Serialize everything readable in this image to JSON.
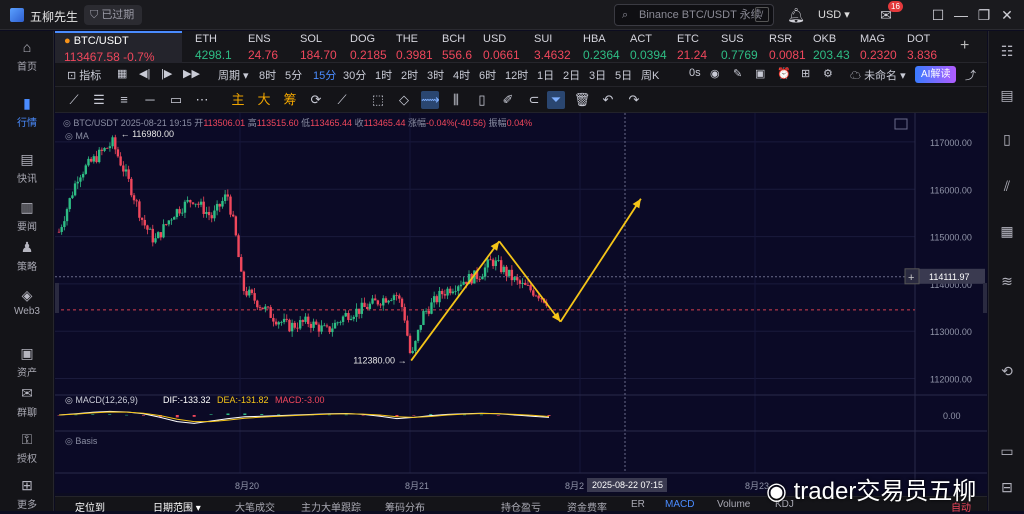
{
  "app": {
    "name": "五柳先生",
    "expired_label": "已过期",
    "search_placeholder": "Binance BTC/USDT 永续",
    "currency": "USD",
    "notification_count": "16"
  },
  "sidebar": [
    {
      "label": "首页",
      "icon": "home-icon",
      "glyph": "⌂"
    },
    {
      "label": "行情",
      "icon": "market-bars-icon",
      "glyph": "▮",
      "active": true
    },
    {
      "label": "快讯",
      "icon": "news-flash-icon",
      "glyph": "▤"
    },
    {
      "label": "要闻",
      "icon": "headline-icon",
      "glyph": "▥"
    },
    {
      "label": "策略",
      "icon": "strategy-icon",
      "glyph": "♟"
    },
    {
      "label": "Web3",
      "icon": "web3-icon",
      "glyph": "◈"
    },
    {
      "label": "资产",
      "icon": "asset-icon",
      "glyph": "▣"
    },
    {
      "label": "群聊",
      "icon": "group-chat-icon",
      "glyph": "✉"
    },
    {
      "label": "授权",
      "icon": "authorize-icon",
      "glyph": "⚿"
    },
    {
      "label": "更多",
      "icon": "more-grid-icon",
      "glyph": "⊞"
    }
  ],
  "tickers": [
    {
      "name": "BTC/USDT",
      "price": "113467.58",
      "change": "-0.7%",
      "dir": "dn"
    },
    {
      "name": "ETH",
      "price": "4298.1",
      "dir": "up"
    },
    {
      "name": "ENS",
      "price": "24.76",
      "dir": "dn"
    },
    {
      "name": "SOL",
      "price": "184.70",
      "dir": "dn"
    },
    {
      "name": "DOG",
      "price": "0.2185",
      "dir": "dn"
    },
    {
      "name": "THE",
      "price": "0.3981",
      "dir": "dn"
    },
    {
      "name": "BCH",
      "price": "556.6",
      "dir": "dn"
    },
    {
      "name": "USD",
      "price": "0.0661",
      "dir": "dn"
    },
    {
      "name": "SUI",
      "price": "3.4632",
      "dir": "dn"
    },
    {
      "name": "HBA",
      "price": "0.2364",
      "dir": "up"
    },
    {
      "name": "ACT",
      "price": "0.0394",
      "dir": "up"
    },
    {
      "name": "ETC",
      "price": "21.24",
      "dir": "dn"
    },
    {
      "name": "SUS",
      "price": "0.7769",
      "dir": "up"
    },
    {
      "name": "RSR",
      "price": "0.0081",
      "dir": "dn"
    },
    {
      "name": "OKB",
      "price": "203.43",
      "dir": "up"
    },
    {
      "name": "MAG",
      "price": "0.2320",
      "dir": "dn"
    },
    {
      "name": "DOT",
      "price": "3.836",
      "dir": "dn"
    }
  ],
  "toolbar": {
    "indicator": "指标",
    "period": "周期",
    "intervals": [
      "8时",
      "5分",
      "15分",
      "30分",
      "1时",
      "2时",
      "3时",
      "4时",
      "6时",
      "12时",
      "1日",
      "2日",
      "3日",
      "5日",
      "周K"
    ],
    "selected_interval": "15分",
    "offset": "0s",
    "unnamed": "未命名",
    "ai": "AI解读"
  },
  "draw_chinese": [
    "主",
    "大",
    "筹"
  ],
  "chart": {
    "legend_symbol": "BTC/USDT",
    "legend_time": "2025-08-21 19:15",
    "open_label": "开",
    "open": "113506.01",
    "high_label": "高",
    "high": "113515.60",
    "low_label": "低",
    "low": "113465.44",
    "close_label": "收",
    "close": "113465.44",
    "change_label": "涨幅",
    "change": "-0.04%(-40.56)",
    "amp_label": "振幅",
    "amp": "0.04%",
    "ma_label": "MA",
    "macd_label": "MACD(12,26,9)",
    "dif_label": "DIF:",
    "dif": "-133.32",
    "dea_label": "DEA:",
    "dea": "-131.82",
    "macd_val_label": "MACD:",
    "macd_val": "-3.00",
    "basis_label": "Basis",
    "high_mark": "116980.00",
    "low_mark": "112380.00",
    "price_ticks": [
      "117000.00",
      "116000.00",
      "115000.00",
      "114000.00",
      "113000.00",
      "112000.00"
    ],
    "macd_zero": "0.00",
    "crosshair_price": "114111.97",
    "date_ticks": [
      "8月20",
      "8月21",
      "8月2",
      "8月23"
    ],
    "crosshair_time": "2025-08-22 07:15",
    "accent_up": "#2ebd85",
    "accent_down": "#f0475c",
    "arrow_color": "#f5c518"
  },
  "chart_data": {
    "type": "candlestick",
    "ylim": [
      111800,
      117400
    ],
    "x_ticks": [
      "8月20",
      "8月21",
      "8月2",
      "8月23"
    ],
    "path_points": [
      [
        0,
        115100
      ],
      [
        5,
        116300
      ],
      [
        10,
        116700
      ],
      [
        14,
        116980
      ],
      [
        18,
        116200
      ],
      [
        22,
        115300
      ],
      [
        25,
        114900
      ],
      [
        30,
        115500
      ],
      [
        35,
        115800
      ],
      [
        40,
        115400
      ],
      [
        44,
        115900
      ],
      [
        46,
        115100
      ],
      [
        48,
        113900
      ],
      [
        52,
        113600
      ],
      [
        56,
        113300
      ],
      [
        60,
        113100
      ],
      [
        65,
        113200
      ],
      [
        70,
        113000
      ],
      [
        75,
        113350
      ],
      [
        80,
        113500
      ],
      [
        85,
        113700
      ],
      [
        88,
        113800
      ],
      [
        90,
        113450
      ],
      [
        92,
        112380
      ],
      [
        95,
        113350
      ],
      [
        100,
        113800
      ],
      [
        105,
        114050
      ],
      [
        110,
        114200
      ],
      [
        113,
        114500
      ],
      [
        116,
        114300
      ],
      [
        120,
        114000
      ],
      [
        125,
        113800
      ],
      [
        128,
        113600
      ]
    ],
    "macd_dif": [
      0,
      20,
      45,
      60,
      50,
      20,
      -40,
      -110,
      -140,
      -100,
      -60,
      -30,
      -20,
      -10,
      0,
      10,
      20,
      25,
      10,
      -20,
      -60,
      -40,
      -10,
      10,
      20,
      30,
      20,
      0,
      -20,
      -40
    ],
    "macd_dea": [
      0,
      15,
      35,
      50,
      48,
      30,
      -10,
      -70,
      -110,
      -110,
      -85,
      -55,
      -35,
      -20,
      -8,
      5,
      15,
      20,
      15,
      0,
      -30,
      -40,
      -25,
      0,
      15,
      25,
      22,
      10,
      -5,
      -25
    ],
    "arrows": [
      [
        "112380",
        "114900"
      ],
      [
        "114900",
        "113200"
      ],
      [
        "113200",
        "115800"
      ]
    ]
  }
}
